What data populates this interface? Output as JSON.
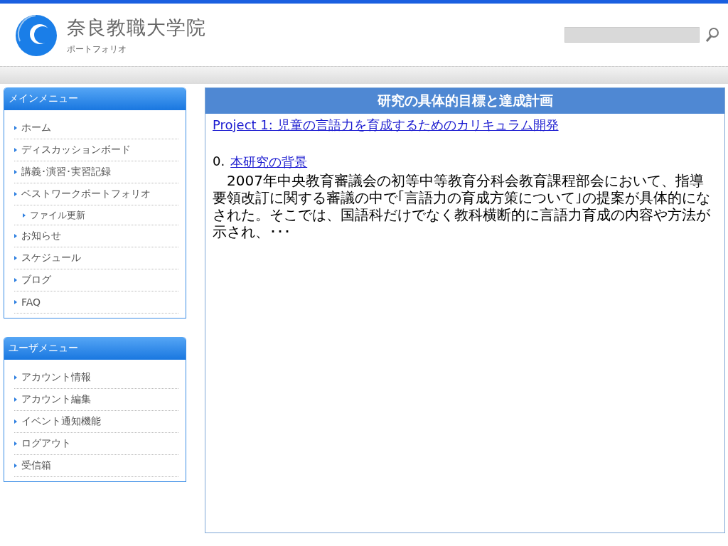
{
  "header": {
    "title": "奈良教職大学院",
    "subtitle": "ポートフォリオ"
  },
  "menus": [
    {
      "title": "メインメニュー",
      "items": [
        {
          "label": "ホーム"
        },
        {
          "label": "ディスカッションボード"
        },
        {
          "label": "講義･演習･実習記録"
        },
        {
          "label": "ベストワークポートフォリオ",
          "children": [
            {
              "label": "ファイル更新"
            }
          ]
        },
        {
          "label": "お知らせ"
        },
        {
          "label": "スケジュール"
        },
        {
          "label": "ブログ"
        },
        {
          "label": "FAQ"
        }
      ]
    },
    {
      "title": "ユーザメニュー",
      "items": [
        {
          "label": "アカウント情報"
        },
        {
          "label": "アカウント編集"
        },
        {
          "label": "イベント通知機能"
        },
        {
          "label": "ログアウト"
        },
        {
          "label": "受信箱"
        }
      ]
    }
  ],
  "content": {
    "title": "研究の具体的目標と達成計画",
    "project_link": "Project 1:  児童の言語力を育成するためのカリキュラム開発",
    "section_number": "0.",
    "section_link": "本研究の背景",
    "paragraph": "2007年中央教育審議会の初等中等教育分科会教育課程部会において、指導要領改訂に関する審議の中で｢言語力の育成方策について｣の提案が具体的になされた。そこでは、国語科だけでなく教科横断的に言語力育成の内容や方法が示され、･･･"
  }
}
